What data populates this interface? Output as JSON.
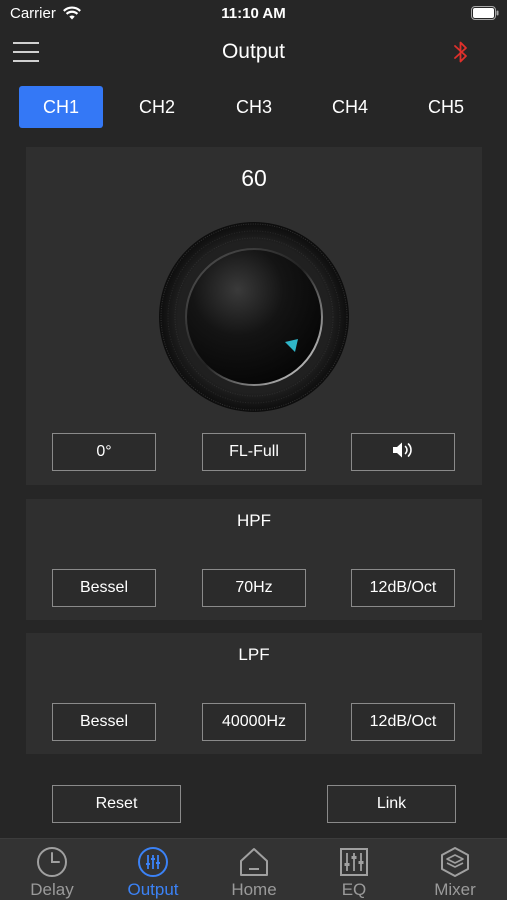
{
  "status_bar": {
    "carrier": "Carrier",
    "time": "11:10 AM"
  },
  "nav": {
    "title": "Output",
    "bluetooth_color": "#e0302b"
  },
  "channels": [
    {
      "label": "CH1",
      "active": true
    },
    {
      "label": "CH2",
      "active": false
    },
    {
      "label": "CH3",
      "active": false
    },
    {
      "label": "CH4",
      "active": false
    },
    {
      "label": "CH5",
      "active": false
    }
  ],
  "output": {
    "volume": "60",
    "phase": "0°",
    "channel_type": "FL-Full",
    "mute_icon": "speaker-icon"
  },
  "hpf": {
    "title": "HPF",
    "filter_type": "Bessel",
    "frequency": "70Hz",
    "slope": "12dB/Oct"
  },
  "lpf": {
    "title": "LPF",
    "filter_type": "Bessel",
    "frequency": "40000Hz",
    "slope": "12dB/Oct"
  },
  "actions": {
    "reset": "Reset",
    "link": "Link"
  },
  "tab_bar": {
    "items": [
      {
        "label": "Delay",
        "icon": "clock-icon",
        "active": false
      },
      {
        "label": "Output",
        "icon": "sliders-icon",
        "active": true
      },
      {
        "label": "Home",
        "icon": "home-icon",
        "active": false
      },
      {
        "label": "EQ",
        "icon": "equalizer-icon",
        "active": false
      },
      {
        "label": "Mixer",
        "icon": "layers-icon",
        "active": false
      }
    ]
  },
  "colors": {
    "accent": "#3478f6",
    "background": "#262626",
    "panel": "#2f2f2f",
    "knob_indicator": "#2fb6c9"
  }
}
